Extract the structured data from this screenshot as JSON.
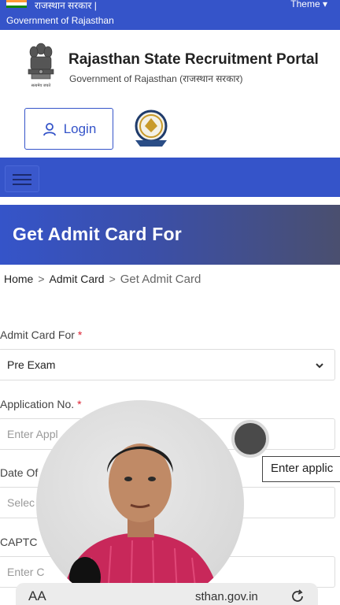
{
  "topbar": {
    "gov_hindi": "राजस्थान सरकार |",
    "gov_english": "Government of Rajasthan",
    "theme_label": "Theme ▾"
  },
  "header": {
    "title": "Rajasthan State Recruitment Portal",
    "subtitle": "Government of Rajasthan (राजस्थान सरकार)",
    "login_label": "Login"
  },
  "banner": {
    "title": "Get Admit Card For"
  },
  "breadcrumb": {
    "items": [
      "Home",
      "Admit Card"
    ],
    "current": "Get Admit Card",
    "separator": ">"
  },
  "form": {
    "admit_card_for": {
      "label": "Admit Card For",
      "value": "Pre Exam"
    },
    "application_no": {
      "label": "Application No.",
      "placeholder": "Enter Appl"
    },
    "dob": {
      "label": "Date Of",
      "placeholder": "Selec"
    },
    "captcha": {
      "label": "CAPTC",
      "placeholder": "Enter C"
    },
    "required_mark": "*"
  },
  "tooltip": {
    "text": "Enter applic"
  },
  "browser": {
    "aa_label": "AA",
    "url": "sthan.gov.in"
  },
  "colors": {
    "primary": "#3554c9",
    "required": "#dd2233"
  }
}
